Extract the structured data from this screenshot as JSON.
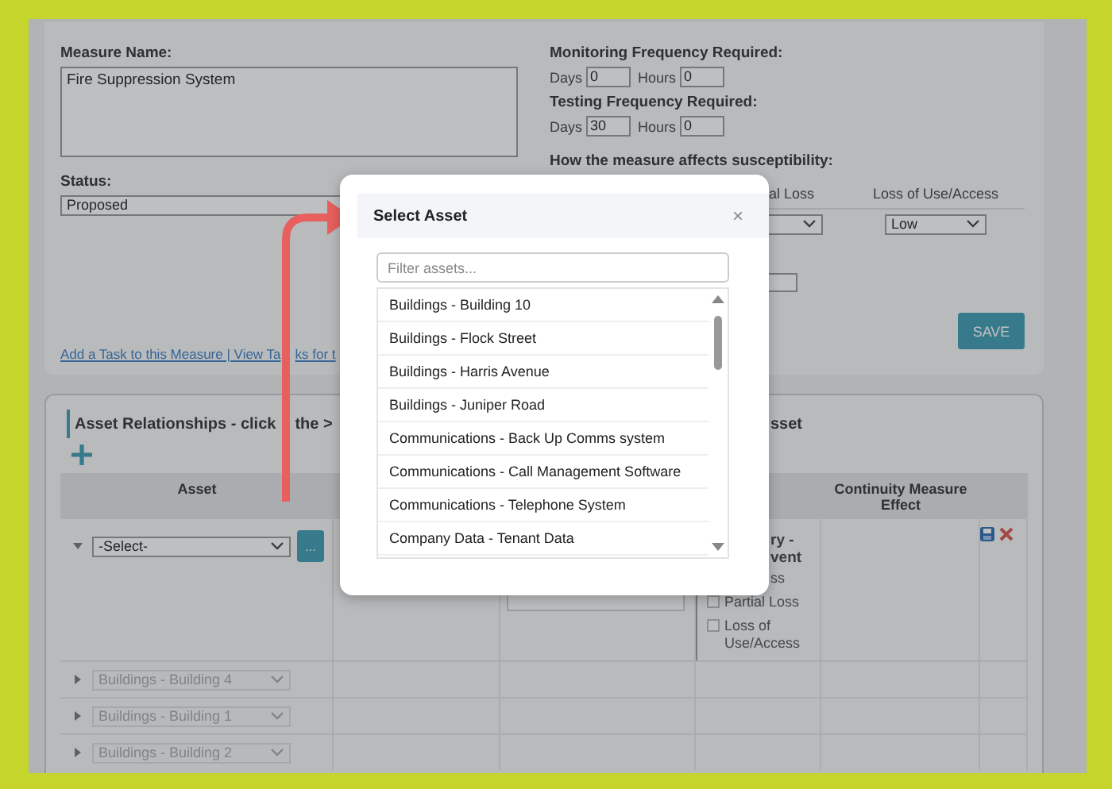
{
  "measure_form": {
    "name_label": "Measure Name:",
    "name_value": "Fire Suppression System",
    "status_label": "Status:",
    "status_value": "Proposed",
    "tasks_link": [
      "Add a Task to this Measure | View Ta",
      "ks for t"
    ],
    "frequencies": [
      {
        "label": "Monitoring Frequency Required:",
        "days_label": "Days",
        "days": "0",
        "hours_label": "Hours",
        "hours": "0"
      },
      {
        "label": "Testing Frequency Required:",
        "days_label": "Days",
        "days": "30",
        "hours_label": "Hours",
        "hours": "0"
      }
    ],
    "susceptibility": {
      "label": "How the measure affects susceptibility:",
      "columns": [
        {
          "header": "al Loss"
        },
        {
          "header": "Loss of Use/Access",
          "value": "Low"
        }
      ]
    },
    "save_button": "SAVE"
  },
  "relationships": {
    "title": [
      "Asset Relationships - click",
      "the >"
    ],
    "title_tail": "sset",
    "columns": [
      "Asset",
      "Continuity Measure Effect"
    ],
    "edit_row": {
      "asset": "-Select-",
      "browse_button": "...",
      "category_fragment": [
        "ry -",
        "vent"
      ],
      "option_fragment": "ss",
      "options": [
        {
          "label": "Partial Loss",
          "checked": false
        },
        {
          "label": "Loss of Use/Access",
          "checked": false
        }
      ]
    },
    "rows": [
      {
        "asset": "Buildings - Building 4"
      },
      {
        "asset": "Buildings - Building 1"
      },
      {
        "asset": "Buildings - Building 2"
      }
    ]
  },
  "modal": {
    "title": "Select Asset",
    "close": "×",
    "filter_placeholder": "Filter assets...",
    "items": [
      {
        "label": "Buildings - Building 10"
      },
      {
        "label": "Buildings - Flock Street"
      },
      {
        "label": "Buildings - Harris Avenue"
      },
      {
        "label": "Buildings - Juniper Road"
      },
      {
        "label": "Communications - Back Up Comms system"
      },
      {
        "label": "Communications - Call Management Software"
      },
      {
        "label": "Communications - Telephone System"
      },
      {
        "label": "Company Data - Tenant Data"
      }
    ]
  }
}
